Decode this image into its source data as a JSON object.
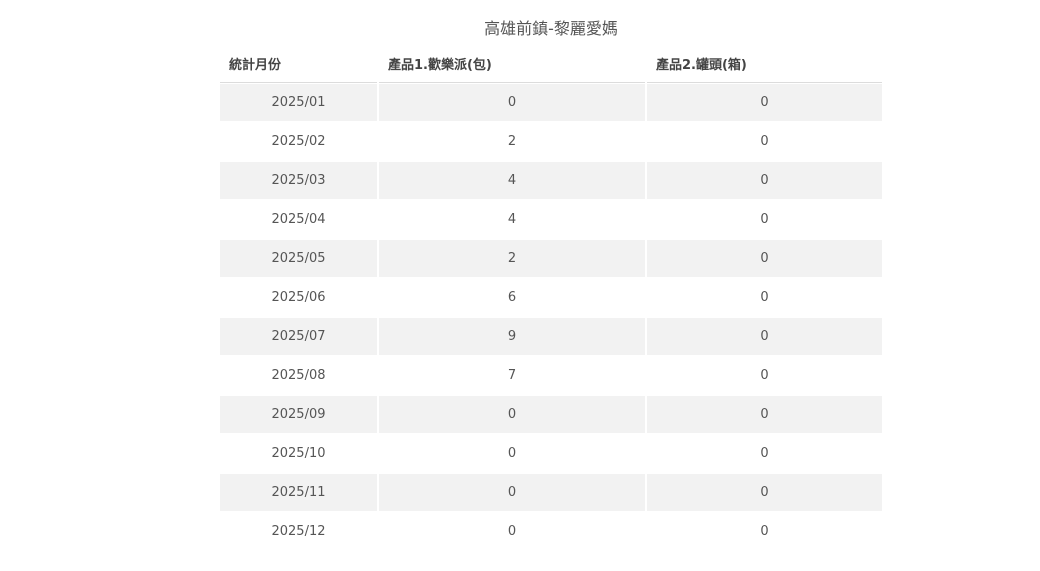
{
  "title": "高雄前鎮-黎麗愛媽",
  "table": {
    "headers": [
      "統計月份",
      "產品1.歡樂派(包)",
      "產品2.罐頭(箱)"
    ],
    "rows": [
      [
        "2025/01",
        "0",
        "0"
      ],
      [
        "2025/02",
        "2",
        "0"
      ],
      [
        "2025/03",
        "4",
        "0"
      ],
      [
        "2025/04",
        "4",
        "0"
      ],
      [
        "2025/05",
        "2",
        "0"
      ],
      [
        "2025/06",
        "6",
        "0"
      ],
      [
        "2025/07",
        "9",
        "0"
      ],
      [
        "2025/08",
        "7",
        "0"
      ],
      [
        "2025/09",
        "0",
        "0"
      ],
      [
        "2025/10",
        "0",
        "0"
      ],
      [
        "2025/11",
        "0",
        "0"
      ],
      [
        "2025/12",
        "0",
        "0"
      ]
    ]
  }
}
